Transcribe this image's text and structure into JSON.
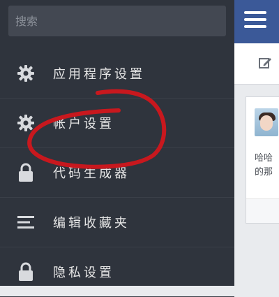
{
  "search": {
    "placeholder": "搜索"
  },
  "menu": {
    "items": [
      {
        "label": "应用程序设置",
        "icon": "gear-icon"
      },
      {
        "label": "帐户设置",
        "icon": "gear-icon"
      },
      {
        "label": "代码生成器",
        "icon": "lock-icon"
      },
      {
        "label": "编辑收藏夹",
        "icon": "list-icon"
      },
      {
        "label": "隐私设置",
        "icon": "lock-icon"
      }
    ]
  },
  "main": {
    "menu_icon": "hamburger-icon",
    "compose_icon": "compose-icon",
    "post": {
      "snippet_line1": "哈哈",
      "snippet_line2": "的那"
    }
  },
  "annotation": {
    "color": "#c8181e",
    "type": "hand-drawn-circle"
  }
}
